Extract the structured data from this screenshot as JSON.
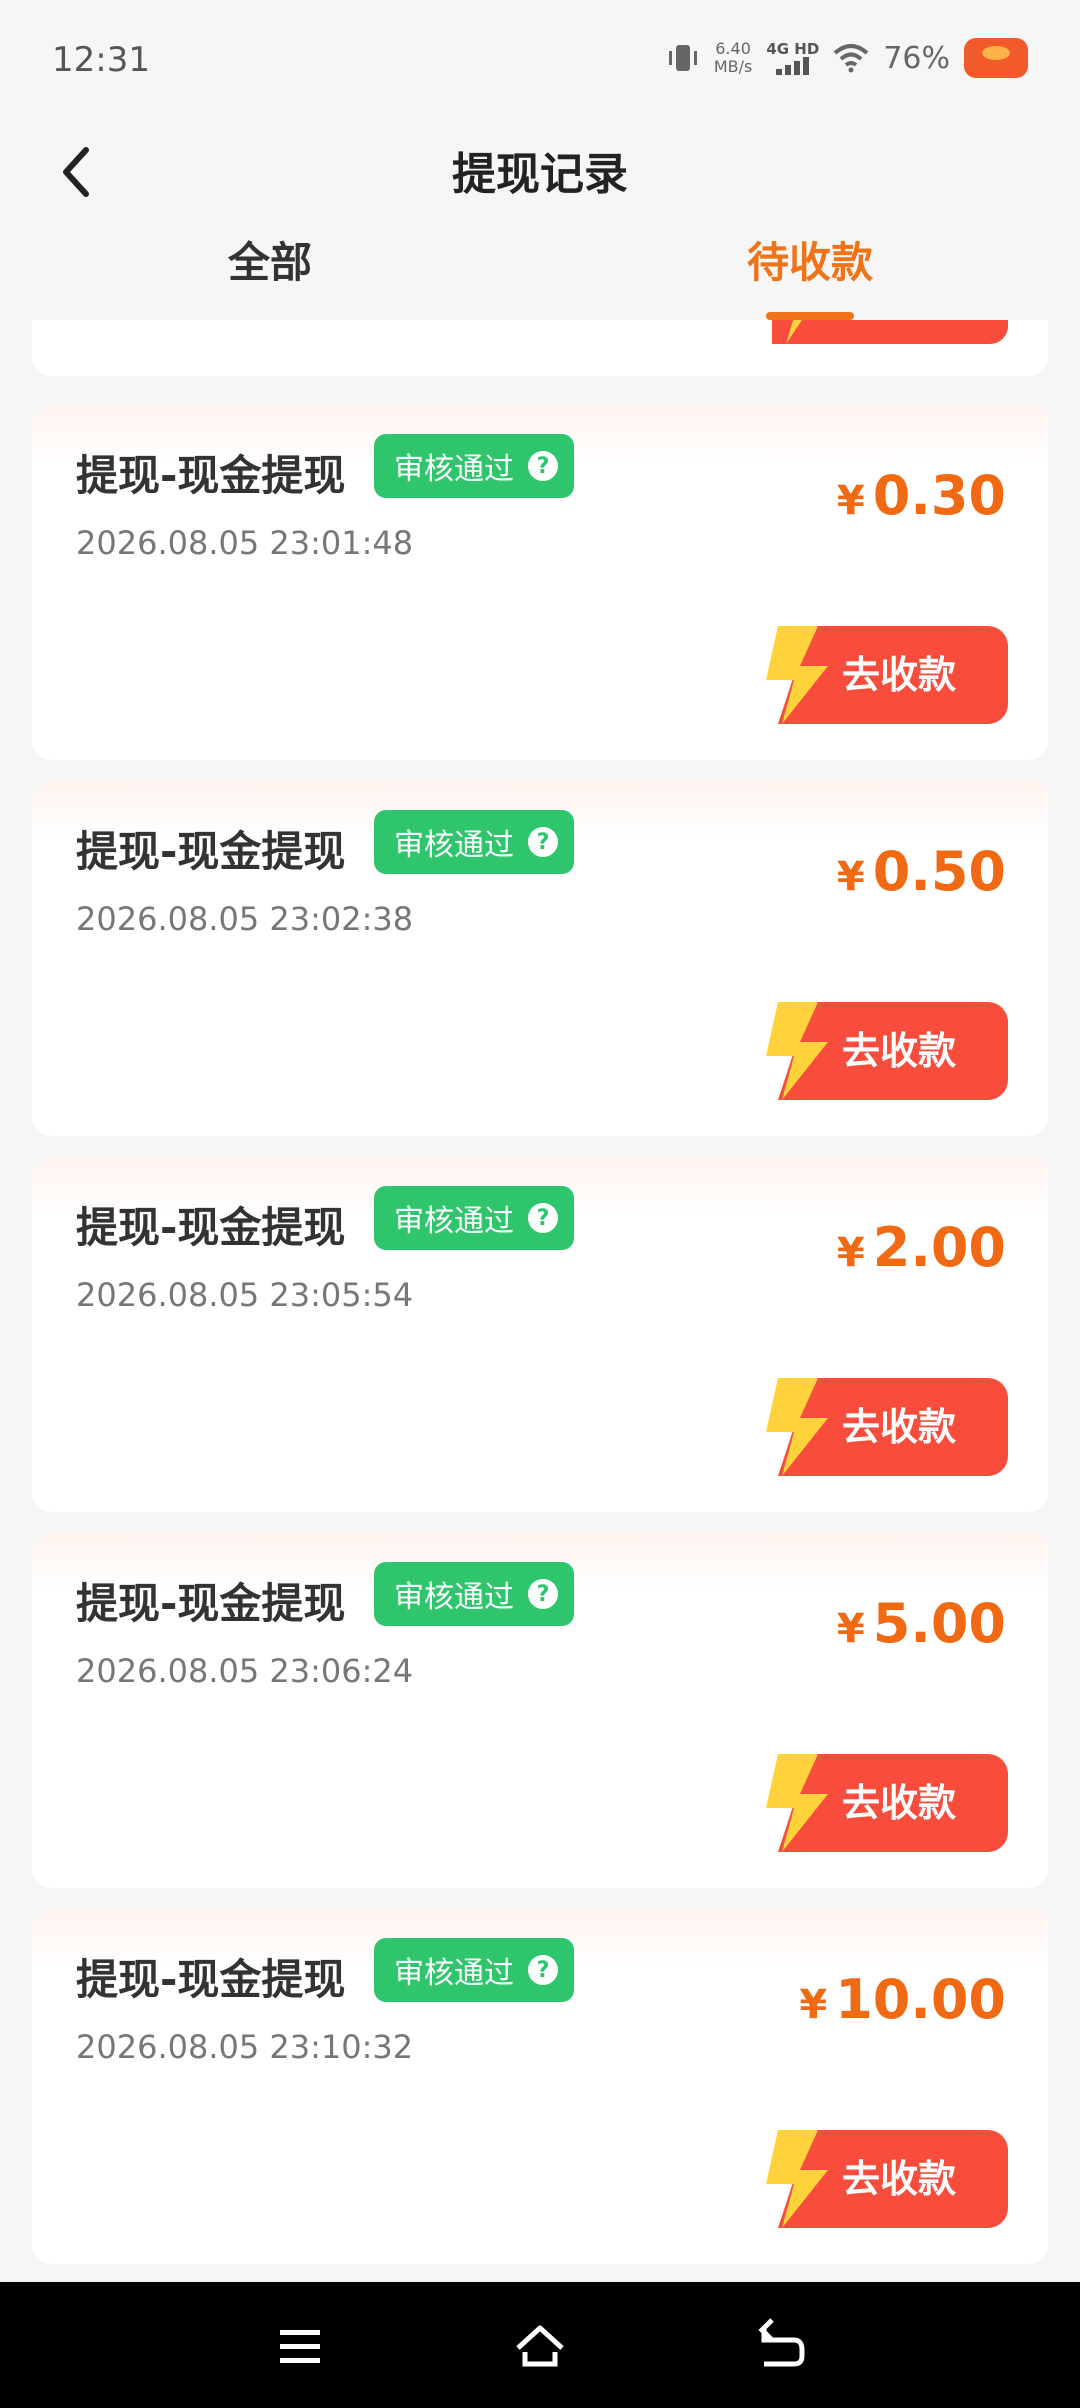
{
  "status_bar": {
    "time": "12:31",
    "net_speed_value": "6.40",
    "net_speed_unit": "MB/s",
    "network_type": "4G HD",
    "battery": "76%"
  },
  "header": {
    "title": "提现记录",
    "back_icon": "chevron-left-icon"
  },
  "tabs": [
    {
      "label": "全部",
      "active": false
    },
    {
      "label": "待收款",
      "active": true
    }
  ],
  "accent_color": "#f07318",
  "records": [
    {
      "title": "提现-现金提现",
      "status": "审核通过",
      "time": "2026.08.05 23:01:48",
      "currency": "¥",
      "amount": "0.30",
      "action": "去收款"
    },
    {
      "title": "提现-现金提现",
      "status": "审核通过",
      "time": "2026.08.05 23:02:38",
      "currency": "¥",
      "amount": "0.50",
      "action": "去收款"
    },
    {
      "title": "提现-现金提现",
      "status": "审核通过",
      "time": "2026.08.05 23:05:54",
      "currency": "¥",
      "amount": "2.00",
      "action": "去收款"
    },
    {
      "title": "提现-现金提现",
      "status": "审核通过",
      "time": "2026.08.05 23:06:24",
      "currency": "¥",
      "amount": "5.00",
      "action": "去收款"
    },
    {
      "title": "提现-现金提现",
      "status": "审核通过",
      "time": "2026.08.05 23:10:32",
      "currency": "¥",
      "amount": "10.00",
      "action": "去收款"
    }
  ],
  "nav_bar": {
    "icons": [
      "menu-icon",
      "home-icon",
      "back-icon"
    ]
  }
}
